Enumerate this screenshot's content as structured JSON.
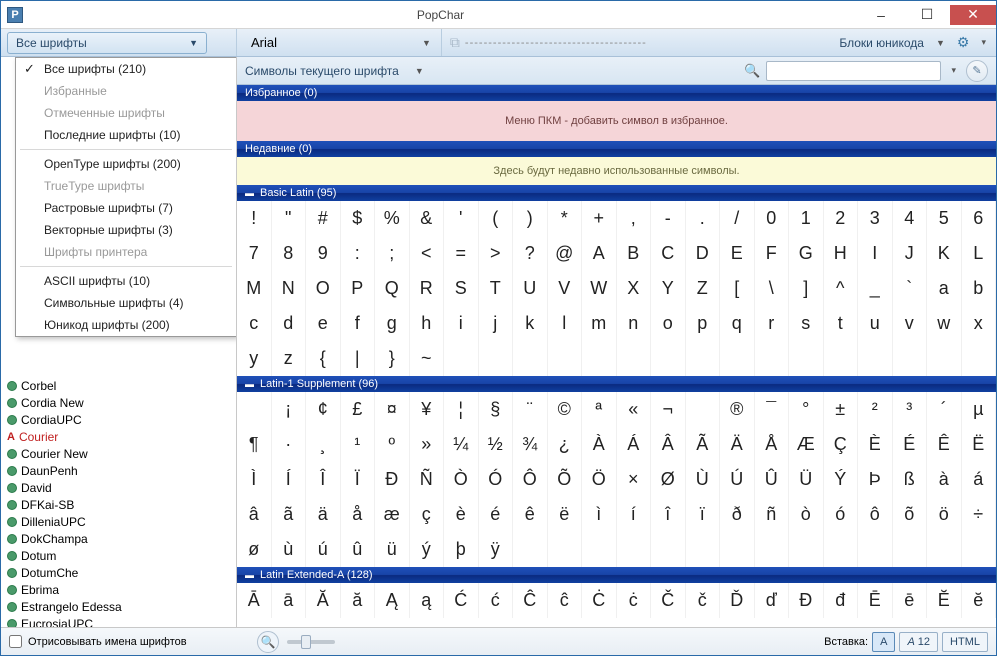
{
  "window": {
    "title": "PopChar",
    "app_letter": "P"
  },
  "toolbar": {
    "font_filter": "Все шрифты",
    "font_name": "Arial",
    "dashes": "---------------------------------------",
    "unicode_blocks": "Блоки юникода"
  },
  "dropdown": {
    "items": [
      {
        "label": "Все шрифты  (210)",
        "check": true,
        "disabled": false
      },
      {
        "label": "Избранные",
        "disabled": true
      },
      {
        "label": "Отмеченные шрифты",
        "disabled": true
      },
      {
        "label": "Последние шрифты  (10)",
        "disabled": false
      },
      "sep",
      {
        "label": "OpenType шрифты  (200)",
        "disabled": false
      },
      {
        "label": "TrueType шрифты",
        "disabled": true
      },
      {
        "label": "Растровые шрифты  (7)",
        "disabled": false
      },
      {
        "label": "Векторные шрифты  (3)",
        "disabled": false
      },
      {
        "label": "Шрифты принтера",
        "disabled": true
      },
      "sep",
      {
        "label": "ASCII шрифты  (10)",
        "disabled": false
      },
      {
        "label": "Символьные шрифты  (4)",
        "disabled": false
      },
      {
        "label": "Юникод шрифты  (200)",
        "disabled": false
      }
    ]
  },
  "fonts": [
    "Corbel",
    "Cordia New",
    "CordiaUPC",
    "Courier",
    "Courier New",
    "DaunPenh",
    "David",
    "DFKai-SB",
    "DilleniaUPC",
    "DokChampa",
    "Dotum",
    "DotumChe",
    "Ebrima",
    "Estrangelo Edessa",
    "EucrosiaUPC"
  ],
  "font_red_index": 3,
  "search": {
    "symbol_filter": "Символы текущего шрифта"
  },
  "sections": {
    "fav_title": "Избранное (0)",
    "fav_msg": "Меню ПКМ - добавить символ в избранное.",
    "recent_title": "Недавние (0)",
    "recent_msg": "Здесь будут недавно использованные символы.",
    "basic_latin_title": "Basic Latin (95)",
    "latin1_title": "Latin-1 Supplement (96)",
    "latin_ext_a_title": "Latin Extended-A (128)"
  },
  "chars": {
    "basic_latin": [
      [
        "!",
        "\"",
        "#",
        "$",
        "%",
        "&",
        "'",
        "(",
        ")",
        "*",
        "+",
        ",",
        "-",
        ".",
        "/",
        "0",
        "1",
        "2",
        "3",
        "4",
        "5",
        "6"
      ],
      [
        "7",
        "8",
        "9",
        ":",
        ";",
        "<",
        "=",
        ">",
        "?",
        "@",
        "A",
        "B",
        "C",
        "D",
        "E",
        "F",
        "G",
        "H",
        "I",
        "J",
        "K",
        "L"
      ],
      [
        "M",
        "N",
        "O",
        "P",
        "Q",
        "R",
        "S",
        "T",
        "U",
        "V",
        "W",
        "X",
        "Y",
        "Z",
        "[",
        "\\",
        "]",
        "^",
        "_",
        "`",
        "a",
        "b"
      ],
      [
        "c",
        "d",
        "e",
        "f",
        "g",
        "h",
        "i",
        "j",
        "k",
        "l",
        "m",
        "n",
        "o",
        "p",
        "q",
        "r",
        "s",
        "t",
        "u",
        "v",
        "w",
        "x"
      ],
      [
        "y",
        "z",
        "{",
        "|",
        "}",
        "~",
        "",
        "",
        "",
        "",
        "",
        "",
        "",
        "",
        "",
        "",
        "",
        "",
        "",
        "",
        "",
        ""
      ]
    ],
    "latin1": [
      [
        " ",
        "¡",
        "¢",
        "£",
        "¤",
        "¥",
        "¦",
        "§",
        "¨",
        "©",
        "ª",
        "«",
        "¬",
        "­",
        "®",
        "¯",
        "°",
        "±",
        "²",
        "³",
        "´",
        "µ"
      ],
      [
        "¶",
        "·",
        "¸",
        "¹",
        "º",
        "»",
        "¼",
        "½",
        "¾",
        "¿",
        "À",
        "Á",
        "Â",
        "Ã",
        "Ä",
        "Å",
        "Æ",
        "Ç",
        "È",
        "É",
        "Ê",
        "Ë"
      ],
      [
        "Ì",
        "Í",
        "Î",
        "Ï",
        "Ð",
        "Ñ",
        "Ò",
        "Ó",
        "Ô",
        "Õ",
        "Ö",
        "×",
        "Ø",
        "Ù",
        "Ú",
        "Û",
        "Ü",
        "Ý",
        "Þ",
        "ß",
        "à",
        "á"
      ],
      [
        "â",
        "ã",
        "ä",
        "å",
        "æ",
        "ç",
        "è",
        "é",
        "ê",
        "ë",
        "ì",
        "í",
        "î",
        "ï",
        "ð",
        "ñ",
        "ò",
        "ó",
        "ô",
        "õ",
        "ö",
        "÷"
      ],
      [
        "ø",
        "ù",
        "ú",
        "û",
        "ü",
        "ý",
        "þ",
        "ÿ",
        "",
        "",
        "",
        "",
        "",
        "",
        "",
        "",
        "",
        "",
        "",
        "",
        "",
        ""
      ]
    ],
    "latin_ext_a": [
      [
        "Ā",
        "ā",
        "Ă",
        "ă",
        "Ą",
        "ą",
        "Ć",
        "ć",
        "Ĉ",
        "ĉ",
        "Ċ",
        "ċ",
        "Č",
        "č",
        "Ď",
        "ď",
        "Đ",
        "đ",
        "Ē",
        "ē",
        "Ĕ",
        "ĕ"
      ]
    ]
  },
  "footer": {
    "render_names": "Отрисовывать имена шрифтов",
    "insert_label": "Вставка:",
    "mode_a": "A",
    "mode_a12": "12",
    "mode_html": "HTML"
  }
}
